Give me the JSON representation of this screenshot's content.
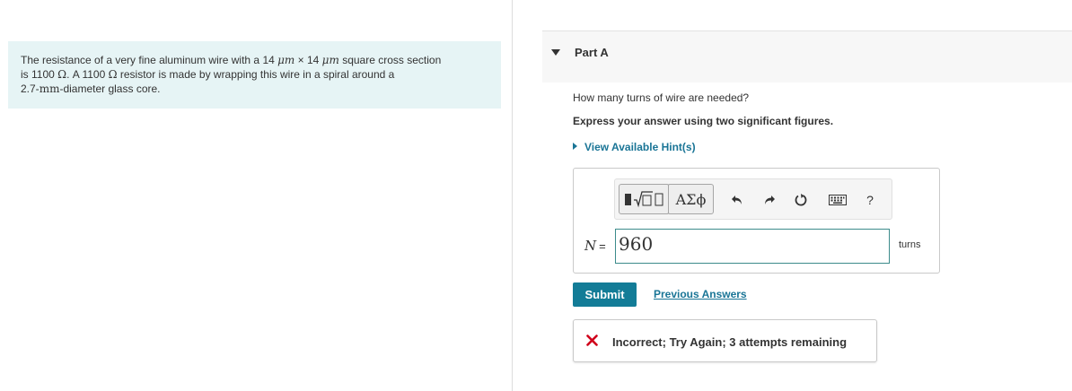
{
  "problem": {
    "line1_pre": "The resistance of a very fine aluminum wire with a 14 ",
    "unit_um": "μm",
    "times": " × 14 ",
    "unit_um2": "μm",
    "line1_post": " square cross section",
    "line2_pre": "is 1100 ",
    "ohm": "Ω",
    "line2_mid": ". A 1100 ",
    "ohm2": "Ω",
    "line2_post": " resistor is made by wrapping this wire in a spiral around a",
    "line3_num": "2.7-",
    "line3_unit": "mm",
    "line3_post": "-diameter glass core."
  },
  "part": {
    "title": "Part A",
    "question": "How many turns of wire are needed?",
    "instruction": "Express your answer using two significant figures.",
    "hint_link": "View Available Hint(s)"
  },
  "toolbar": {
    "greek_label": "ΑΣϕ",
    "help_label": "?"
  },
  "answer": {
    "variable": "N",
    "equals": "=",
    "value": "960",
    "unit": "turns"
  },
  "actions": {
    "submit_label": "Submit",
    "previous_answers_label": "Previous Answers"
  },
  "feedback": {
    "message": "Incorrect; Try Again; 3 attempts remaining",
    "status_color": "#d0021b"
  },
  "colors": {
    "accent": "#137c97",
    "link": "#1a7596",
    "problem_bg": "#e6f4f5"
  }
}
